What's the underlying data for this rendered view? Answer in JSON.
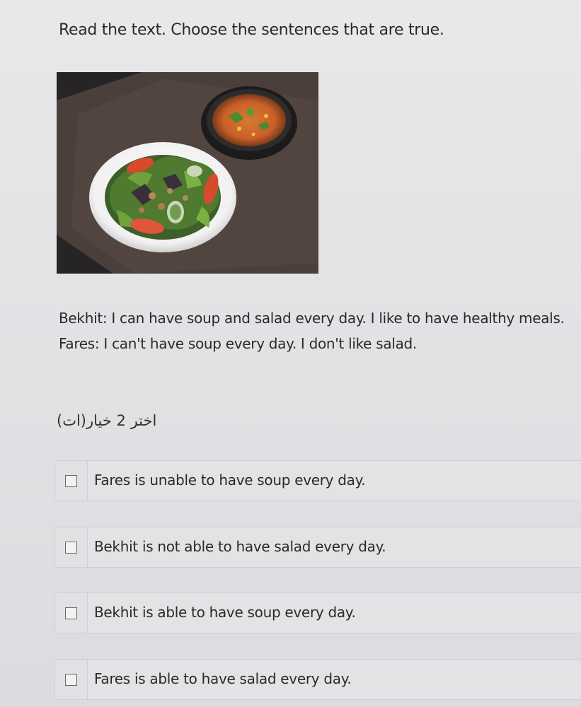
{
  "question": {
    "prompt": "Read the text. Choose the sentences that are true."
  },
  "image": {
    "subject": "soup and salad"
  },
  "passage": {
    "lines": [
      "Bekhit: I can have soup and salad every day. I like to have healthy meals.",
      "Fares: I can't have soup every day. I don't like salad."
    ]
  },
  "instruction": {
    "text": "اختر 2 خيار(ات)"
  },
  "options": [
    {
      "label": "Fares is unable to have soup every day.",
      "checked": false
    },
    {
      "label": "Bekhit is not able to have salad every day.",
      "checked": false
    },
    {
      "label": "Bekhit is able to have soup every day.",
      "checked": false
    },
    {
      "label": "Fares is able to have salad every day.",
      "checked": false
    }
  ],
  "colors": {
    "background": "#e4e4e7",
    "text": "#2a2a2a",
    "border": "#cfcfd3"
  }
}
